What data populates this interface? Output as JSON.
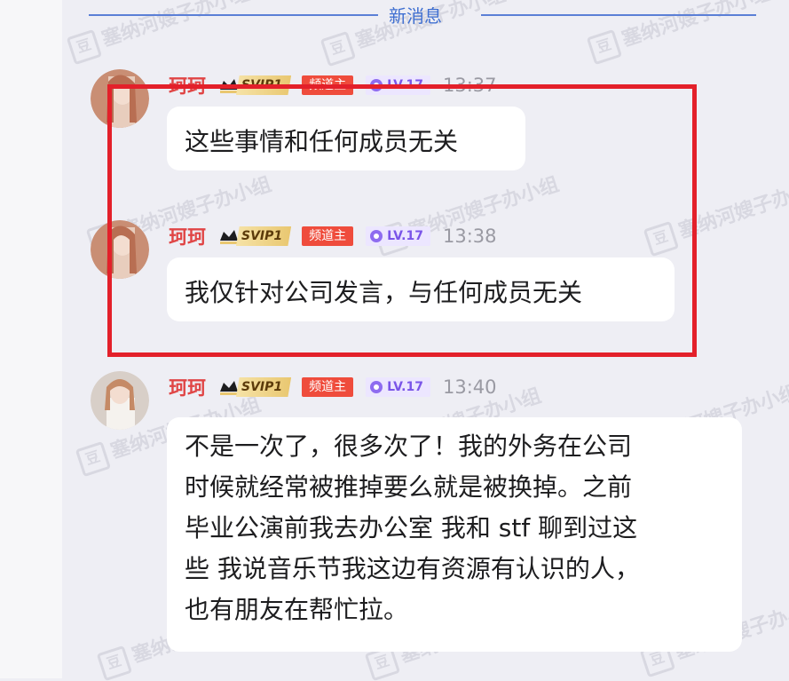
{
  "divider": {
    "label": "新消息"
  },
  "watermark": {
    "text": "塞纳河嫂子办小组",
    "icon": "豆"
  },
  "messages": [
    {
      "user": "珂珂",
      "svip": "SVIP1",
      "role": "频道主",
      "level": "LV.17",
      "time": "13:37",
      "text": "这些事情和任何成员无关"
    },
    {
      "user": "珂珂",
      "svip": "SVIP1",
      "role": "频道主",
      "level": "LV.17",
      "time": "13:38",
      "text": "我仅针对公司发言，与任何成员无关"
    },
    {
      "user": "珂珂",
      "svip": "SVIP1",
      "role": "频道主",
      "level": "LV.17",
      "time": "13:40",
      "lines": [
        "不是一次了，很多次了！我的外务在公司",
        "时候就经常被推掉要么就是被换掉。之前",
        "毕业公演前我去办公室 我和 stf 聊到过这",
        "些 我说音乐节我这边有资源有认识的人，",
        "也有朋友在帮忙拉。"
      ]
    }
  ],
  "colors": {
    "accent": "#3f6fd1",
    "name": "#e04545",
    "highlight": "#e3202a",
    "owner_badge": "#ef4c3c",
    "level": "#7a55e8"
  }
}
